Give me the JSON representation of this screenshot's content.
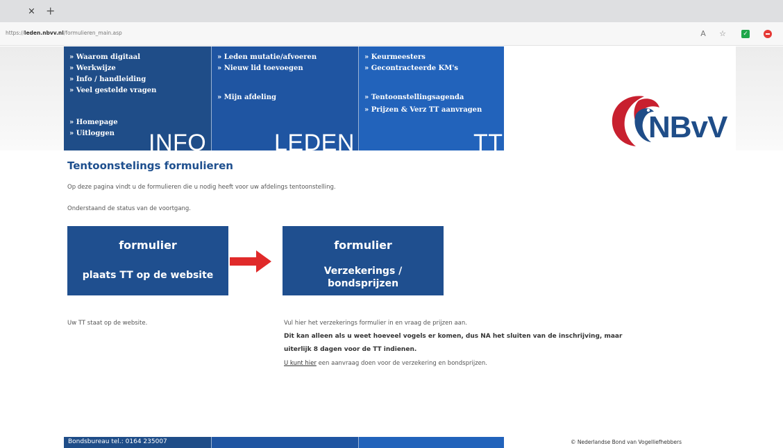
{
  "browser": {
    "close_glyph": "×",
    "new_tab_glyph": "+",
    "url_prefix": "https://",
    "url_domain": "leden.nbvv.nl",
    "url_path": "/formulieren_main.asp"
  },
  "nav": {
    "info": {
      "links": [
        "» Waarom digitaal",
        "» Werkwijze",
        "» Info / handleiding",
        "» Veel gestelde vragen",
        "» Homepage",
        "» Uitloggen"
      ],
      "big": "INFO"
    },
    "leden": {
      "links": [
        "» Leden mutatie/afvoeren",
        "» Nieuw lid toevoegen",
        "» Mijn afdeling"
      ],
      "big": "LEDEN"
    },
    "tt": {
      "links": [
        "» Keurmeesters",
        "» Gecontracteerde KM's",
        "» Tentoonstellingsagenda",
        "» Prijzen & Verz TT aanvragen"
      ],
      "big": "TT"
    }
  },
  "logo": {
    "text": "NBvV",
    "red": "#c8202f",
    "blue": "#1f4d88"
  },
  "content": {
    "title": "Tentoonstelings formulieren",
    "intro": "Op deze pagina vindt u de formulieren die u nodig heeft voor uw afdelings tentoonstelling.",
    "status": "Onderstaand de status van de voortgang.",
    "box1": {
      "heading": "formulier",
      "sub": "plaats TT op de website"
    },
    "box2": {
      "heading": "formulier",
      "sub_line1": "Verzekerings /",
      "sub_line2": "bondsprijzen"
    },
    "left_note": "Uw TT staat op de website.",
    "right_note": "Vul hier het verzekerings formulier in en vraag de prijzen aan.",
    "bold_line1": "Dit kan alleen als u weet hoeveel vogels er komen, dus NA het sluiten van de inschrijving, maar",
    "bold_line2": "uiterlijk 8 dagen voor de TT indienen.",
    "link_text": "U kunt hier",
    "link_after": " een aanvraag doen voor de verzekering en bondsprijzen."
  },
  "footer": {
    "tel": "Bondsbureau tel.: 0164 235007",
    "copyright": "© Nederlandse Bond van Vogelliefhebbers"
  },
  "colors": {
    "nav_dark": "#1f4d88",
    "arrow": "#e02a2a"
  }
}
